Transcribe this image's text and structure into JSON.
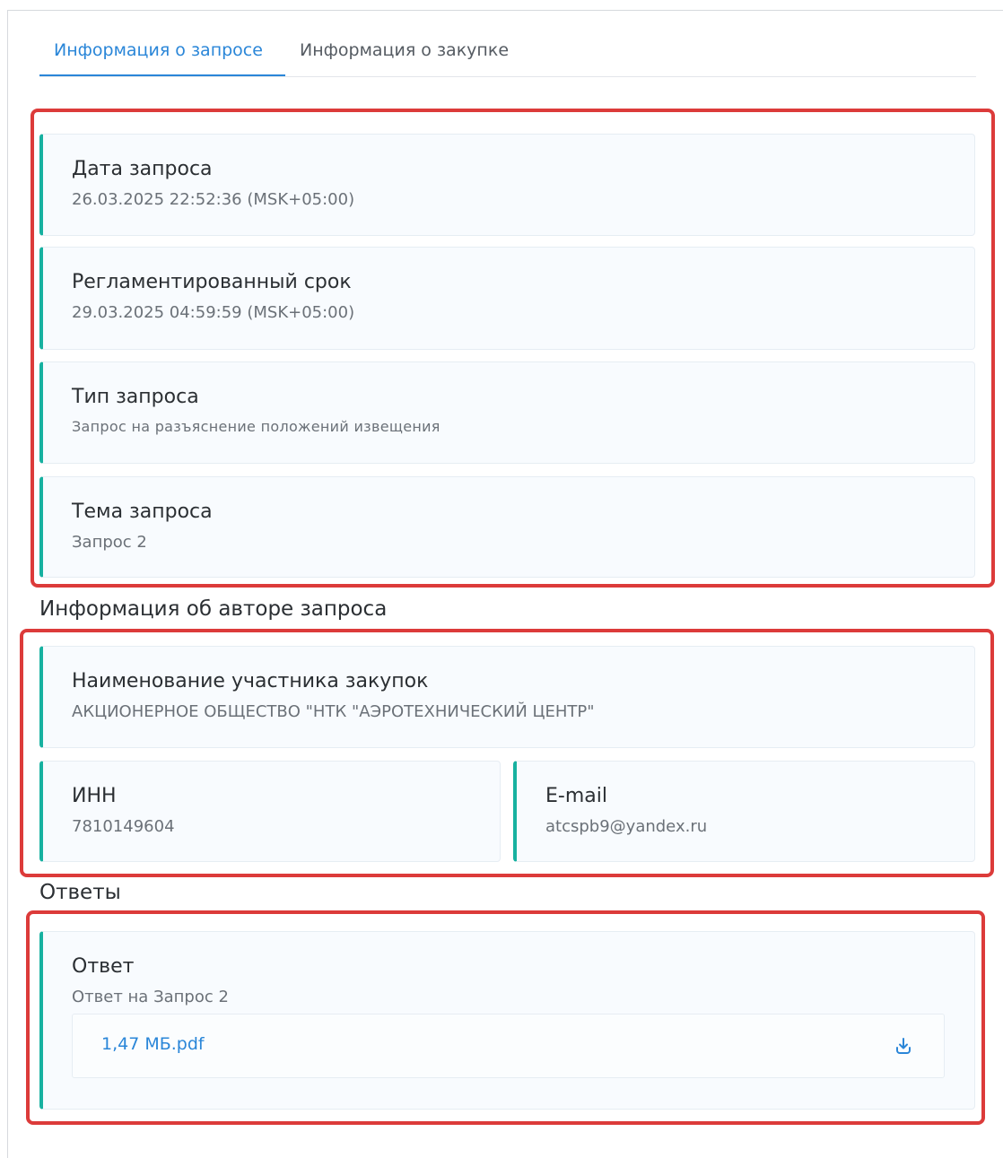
{
  "tabs": [
    {
      "label": "Информация о запросе",
      "active": true
    },
    {
      "label": "Информация о закупке",
      "active": false
    }
  ],
  "request_info": {
    "date": {
      "label": "Дата запроса",
      "value": "26.03.2025 22:52:36 (MSK+05:00)"
    },
    "deadline": {
      "label": "Регламентированный срок",
      "value": "29.03.2025 04:59:59 (MSK+05:00)"
    },
    "type": {
      "label": "Тип запроса",
      "value": "Запрос на разъяснение положений извещения"
    },
    "subject": {
      "label": "Тема запроса",
      "value": "Запрос 2"
    }
  },
  "author_section": {
    "title": "Информация об авторе запроса",
    "participant": {
      "label": "Наименование участника закупок",
      "value": "АКЦИОНЕРНОЕ ОБЩЕСТВО \"НТК \"АЭРОТЕХНИЧЕСКИЙ ЦЕНТР\""
    },
    "inn": {
      "label": "ИНН",
      "value": "7810149604"
    },
    "email": {
      "label": "E-mail",
      "value": "atcspb9@yandex.ru"
    }
  },
  "answers_section": {
    "title": "Ответы",
    "answer": {
      "label": "Ответ",
      "value": "Ответ на Запрос 2",
      "file_name": "1,47 МБ.pdf",
      "download_icon": "download-icon"
    }
  },
  "colors": {
    "accent": "#2a86d8",
    "card_border": "#17b1a0",
    "highlight": "#dc3b3a"
  }
}
